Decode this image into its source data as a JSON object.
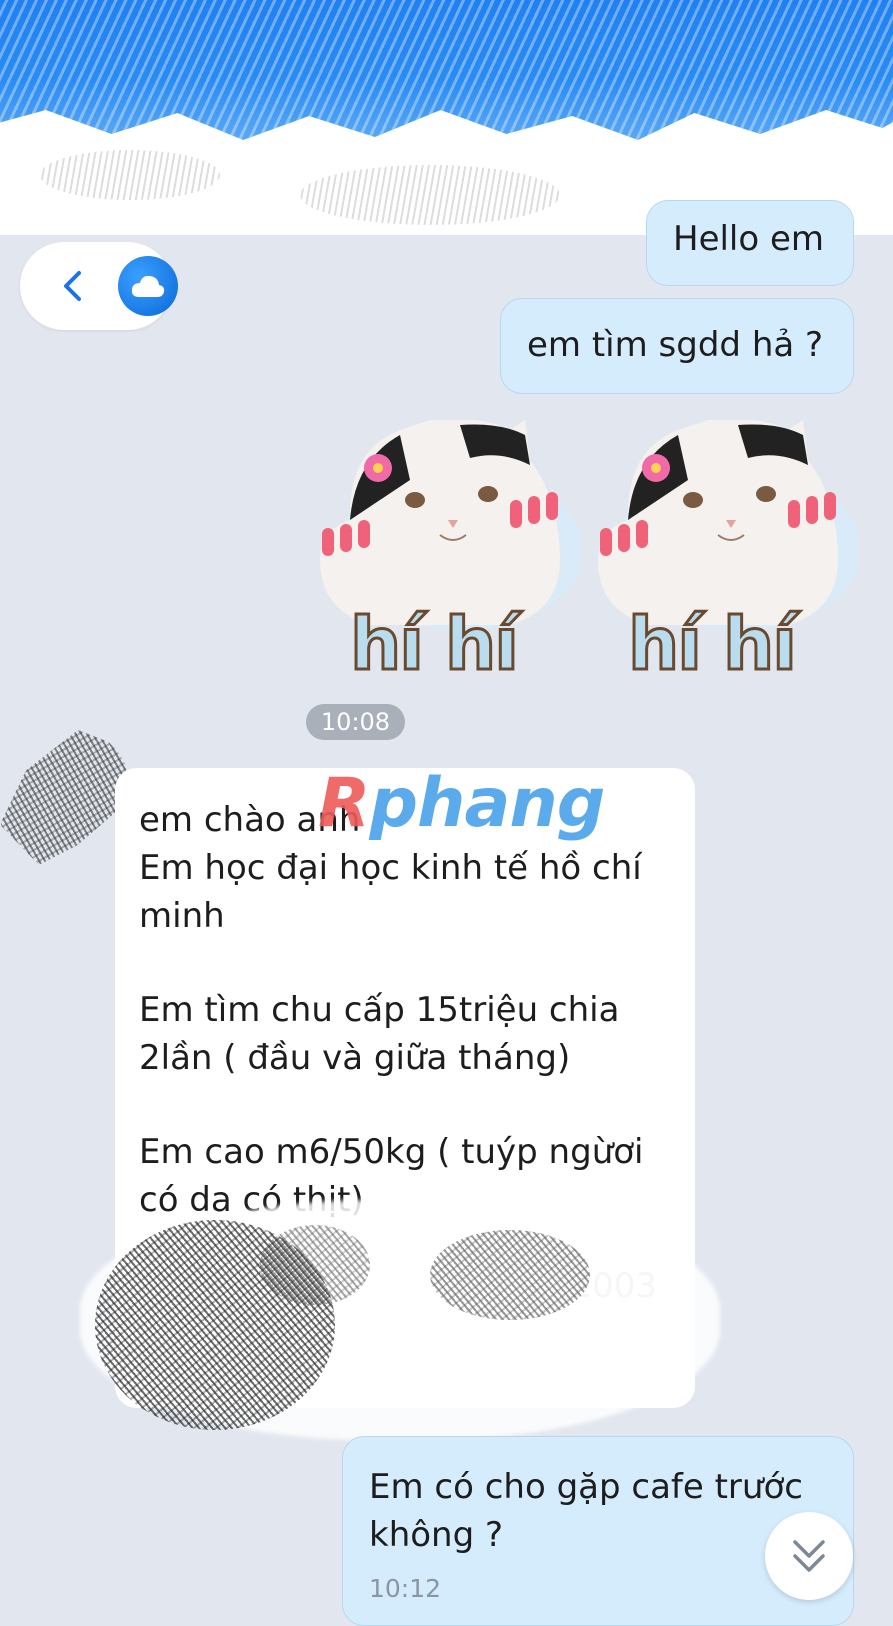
{
  "header": {
    "back_label": "Back",
    "cloud_icon": "cloud-icon"
  },
  "messages": {
    "hello": "Hello em",
    "sgdd": "em tìm sgdd hả ?",
    "sticker_text": "hí hí",
    "time_1": "10:08",
    "intro_line_1": "em  chào anh\nEm học đại học kinh tế hồ chí minh",
    "intro_line_2": "Em tìm chu cấp 15triệu chia 2lần ( đầu và giữa tháng)",
    "intro_line_3": "Em cao m6/50kg ( tuýp ngừơi có da có thịt)",
    "intro_year": "2003",
    "cafe": "Em có cho gặp cafe trước không ?",
    "time_2": "10:12"
  },
  "watermark": {
    "prefix": "R",
    "text": "phang"
  },
  "colors": {
    "outgoing_bubble": "#d5ecfd",
    "incoming_bubble": "#ffffff",
    "chat_background": "#e2e7ef",
    "accent": "#1a73e8"
  }
}
